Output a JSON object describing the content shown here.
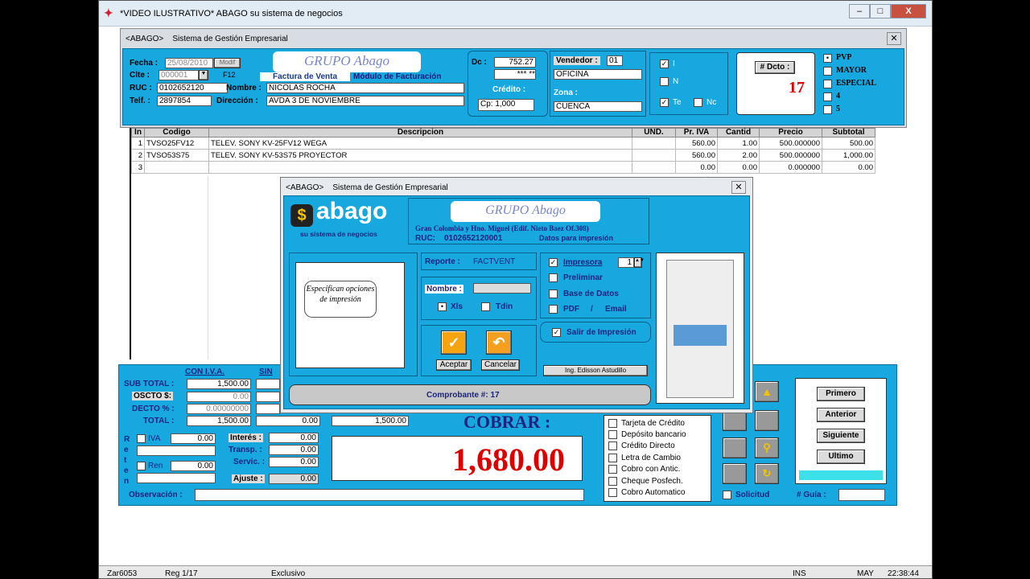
{
  "window": {
    "title": "*VIDEO ILUSTRATIVO* ABAGO su sistema de negocios",
    "min": "–",
    "max": "□",
    "close": "X"
  },
  "header_panel": {
    "title": "<ABAGO>    Sistema de Gestión Empresarial",
    "fecha_label": "Fecha :",
    "fecha": "25/08/2010",
    "modif": "Modif",
    "clte_label": "Clte :",
    "clte": "000001",
    "f12": "F12",
    "ruc_label": "RUC :",
    "ruc": "0102652120",
    "nombre_label": "Nombre :",
    "nombre": "NICOLAS ROCHA",
    "telf_label": "Telf. :",
    "telf": "2897854",
    "direccion_label": "Dirección :",
    "direccion": "AVDA 3 DE NOVIEMBRE",
    "logo": "GRUPO Abago",
    "subtitle1": "Factura de Venta",
    "subtitle2": "Módulo de Facturación",
    "dc_label": "Dc :",
    "dc_value": "752.27",
    "dc_extra": "*** **",
    "credito_label": "Crédito :",
    "credito": "Cp: 1,000",
    "vendedor_label": "Vendedor :",
    "vendedor_code": "01",
    "vendedor": "OFICINA",
    "zona_label": "Zona :",
    "zona": "CUENCA",
    "opts": [
      "I",
      "N",
      "Te",
      "Nc"
    ],
    "dcto_button": "# Dcto :",
    "dcto_number": "17",
    "price_options": [
      "PVP",
      "MAYOR",
      "ESPECIAL",
      "4",
      "5"
    ]
  },
  "grid": {
    "headers": [
      "In",
      "Codigo",
      "Descripcion",
      "UND.",
      "Pr. IVA",
      "Cantid",
      "Precio",
      "Subtotal"
    ],
    "rows": [
      [
        "1",
        "TVSO25FV12",
        "TELEV. SONY KV-25FV12 WEGA",
        "",
        "560.00",
        "1.00",
        "500.000000",
        "500.00"
      ],
      [
        "2",
        "TVSO53S75",
        "TELEV. SONY KV-53S75 PROYECTOR",
        "",
        "560.00",
        "2.00",
        "500.000000",
        "1,000.00"
      ],
      [
        "3",
        "",
        "",
        "",
        "0.00",
        "0.00",
        "0.000000",
        "0.00"
      ]
    ]
  },
  "totals": {
    "con_iva": "CON I.V.A.",
    "sin": "SIN",
    "subtotal_label": "SUB TOTAL :",
    "subtotal": "1,500.00",
    "oscto_label": "OSCTO $:",
    "oscto": "0.00",
    "decto_label": "DECTO % :",
    "decto": "0.00000000",
    "total_label": "TOTAL :",
    "total": "1,500.00",
    "total_sin": "0.00",
    "total_right": "1,500.00",
    "reten_label": "R e t e n",
    "iva_label": "IVA",
    "iva_val": "0.00",
    "ren_label": "Ren",
    "ren_val": "0.00",
    "interes_label": "Interés :",
    "interes": "0.00",
    "transp_label": "Transp. :",
    "transp": "0.00",
    "servic_label": "Servic. :",
    "servic": "0.00",
    "ajuste_label": "Ajuste :",
    "ajuste": "0.00",
    "observacion_label": "Observación :",
    "cobrar_label": "COBRAR :",
    "cobrar_amount": "1,680.00"
  },
  "payments": [
    "Tarjeta de Crédito",
    "Depósito bancario",
    "Crédito Directo",
    "Letra de Cambio",
    "Cobro con Antic.",
    "Cheque Posfech.",
    "Cobro Automatico"
  ],
  "solicitud": "Solicitud",
  "guia_label": "# Guía :",
  "nav": {
    "first": "Primero",
    "prev": "Anterior",
    "next": "Siguiente",
    "last": "Ultimo"
  },
  "dialog": {
    "title": "<ABAGO>    Sistema de Gestión Empresarial",
    "logo_word": "abago",
    "logo_tag": "su sistema de negocios",
    "logo_grupo": "GRUPO Abago",
    "address": "Gran Colombia y Hno. Miguel (Edif. Nieto Baez Of.308)",
    "ruc_label": "RUC:",
    "ruc": "0102652120001",
    "datos": "Datos para impresión",
    "note": "Especifican opciones de impresión",
    "reporte_label": "Reporte :",
    "reporte": "FACTVENT",
    "nombre_label": "Nombre :",
    "xls": "Xls",
    "tdin": "Tdin",
    "impresora": "Impresora",
    "copies": "1",
    "preliminar": "Preliminar",
    "base_datos": "Base de Datos",
    "pdf": "PDF",
    "slash": "/",
    "email": "Email",
    "salir": "Salir de Impresión",
    "aceptar": "Aceptar",
    "cancelar": "Cancelar",
    "author": "Ing. Edisson Astudillo",
    "comprobante": "Comprobante #: 17"
  },
  "statusbar": {
    "a": "Zar6053",
    "b": "Reg 1/17",
    "c": "Exclusivo",
    "ins": "INS",
    "may": "MAY",
    "time": "22:38:44"
  }
}
